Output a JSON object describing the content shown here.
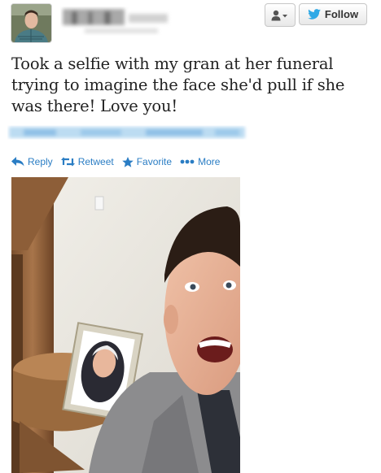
{
  "tweet": {
    "text": "Took a selfie with my gran at her funeral trying to imagine the face she'd pull if she was there! Love you!"
  },
  "header": {
    "follow_label": "Follow",
    "user_menu_icon": "person-dropdown-icon",
    "follow_icon": "twitter-bird-icon"
  },
  "actions": [
    {
      "label": "Reply",
      "icon": "reply-arrow-icon"
    },
    {
      "label": "Retweet",
      "icon": "retweet-icon"
    },
    {
      "label": "Favorite",
      "icon": "star-icon"
    },
    {
      "label": "More",
      "icon": "more-dots-icon"
    }
  ],
  "colors": {
    "link_blue": "#2a7dc4",
    "follow_bird": "#2fa9e6",
    "text": "#222222"
  }
}
